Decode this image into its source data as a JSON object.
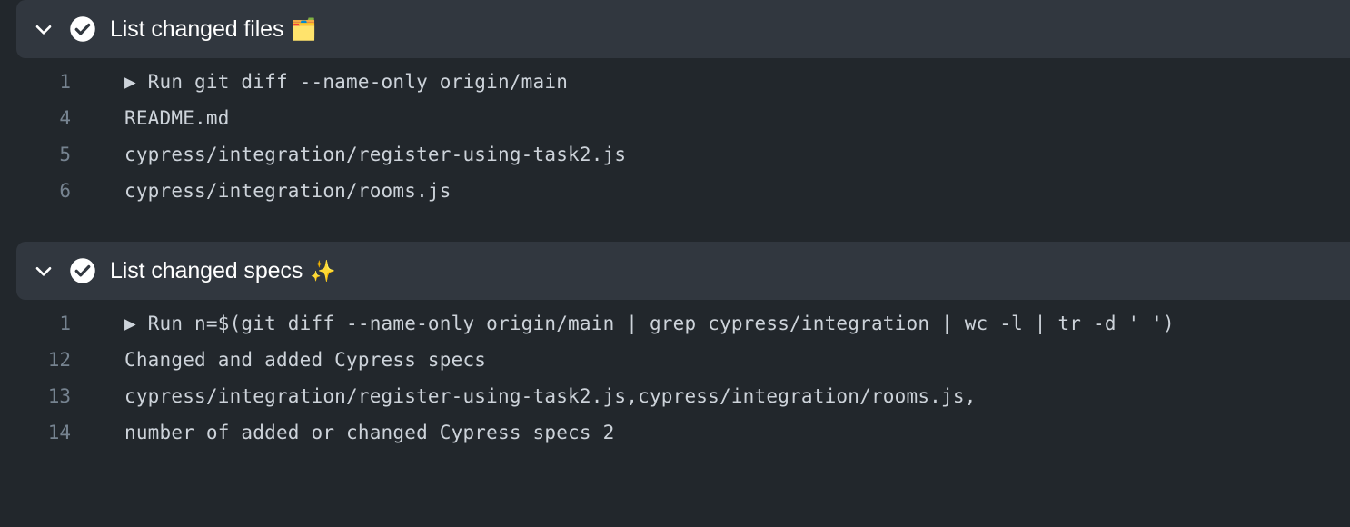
{
  "theme": {
    "page_bg": "#22272c",
    "header_bg": "#31373f",
    "header_text": "#ffffff",
    "log_text": "#cdd3da",
    "line_number_text": "#768390",
    "status_icon_fill": "#ffffff"
  },
  "steps": [
    {
      "id": "list-changed-files",
      "title": "List changed files",
      "emoji": "🗂️",
      "emoji_name": "card-index-dividers-emoji",
      "status": "success",
      "status_icon": "check-circle-icon",
      "expanded": true,
      "chevron_icon": "chevron-down-icon",
      "lines": [
        {
          "no": "1",
          "text": "▶ Run git diff --name-only origin/main"
        },
        {
          "no": "4",
          "text": "README.md"
        },
        {
          "no": "5",
          "text": "cypress/integration/register-using-task2.js"
        },
        {
          "no": "6",
          "text": "cypress/integration/rooms.js"
        }
      ]
    },
    {
      "id": "list-changed-specs",
      "title": "List changed specs",
      "emoji": "✨",
      "emoji_name": "sparkles-emoji",
      "status": "success",
      "status_icon": "check-circle-icon",
      "expanded": true,
      "chevron_icon": "chevron-down-icon",
      "lines": [
        {
          "no": "1",
          "text": "▶ Run n=$(git diff --name-only origin/main | grep cypress/integration | wc -l | tr -d ' ')"
        },
        {
          "no": "12",
          "text": "Changed and added Cypress specs"
        },
        {
          "no": "13",
          "text": "cypress/integration/register-using-task2.js,cypress/integration/rooms.js,"
        },
        {
          "no": "14",
          "text": "number of added or changed Cypress specs 2"
        }
      ]
    }
  ]
}
